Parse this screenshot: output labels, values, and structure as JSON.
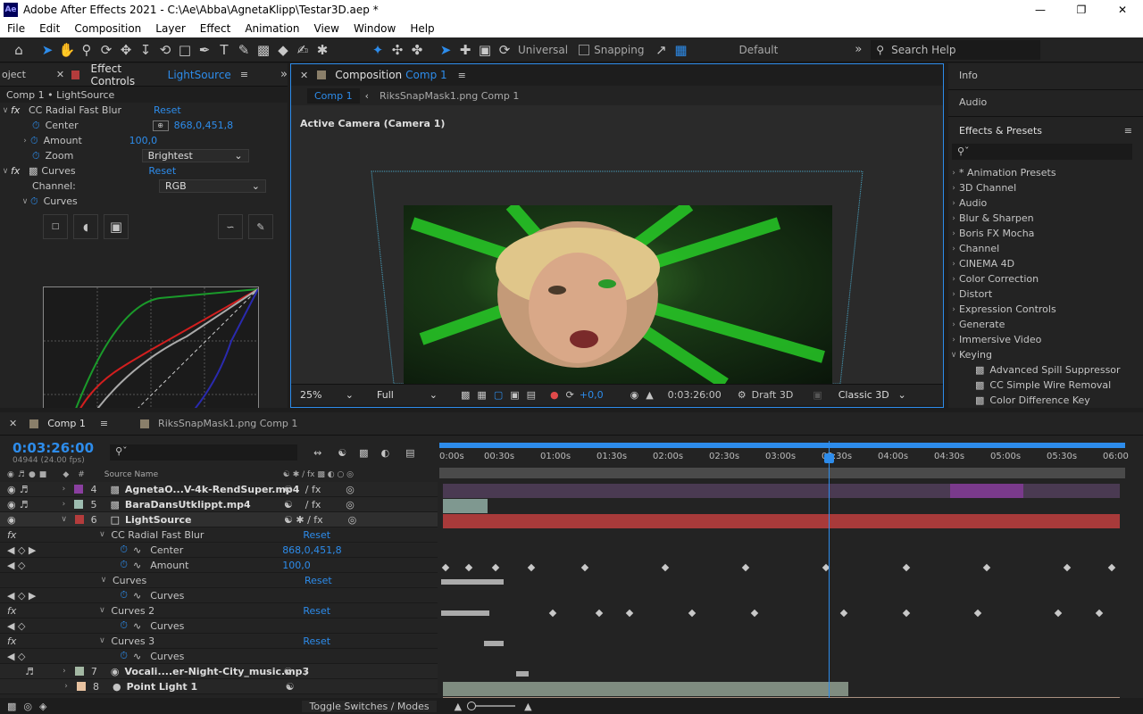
{
  "window": {
    "title": "Adobe After Effects 2021 - C:\\Ae\\Abba\\AgnetaKlipp\\Testar3D.aep *",
    "logo": "Ae"
  },
  "menu": [
    "File",
    "Edit",
    "Composition",
    "Layer",
    "Effect",
    "Animation",
    "View",
    "Window",
    "Help"
  ],
  "toolbar": {
    "axis_mode": "Universal",
    "snapping": "Snapping",
    "workspace": "Default",
    "search_placeholder": "Search Help"
  },
  "left": {
    "tab_project": "oject",
    "tab_effect_controls": "Effect Controls",
    "tab_layer": "LightSource",
    "breadcrumb": "Comp 1 • LightSource",
    "effects": [
      {
        "name": "CC Radial Fast Blur",
        "reset": "Reset"
      },
      {
        "name": "Curves",
        "reset": "Reset"
      }
    ],
    "center_label": "Center",
    "center_value": "868,0,451,8",
    "amount_label": "Amount",
    "amount_value": "100,0",
    "zoom_label": "Zoom",
    "zoom_value": "Brightest",
    "channel_label": "Channel:",
    "channel_value": "RGB",
    "curves_label": "Curves"
  },
  "comp": {
    "tab_label": "Composition",
    "tab_comp": "Comp 1",
    "crumb1": "Comp 1",
    "crumb2": "RiksSnapMask1.png Comp 1",
    "camera": "Active Camera (Camera 1)",
    "zoom": "25%",
    "resolution": "Full",
    "exposure": "+0,0",
    "timecode": "0:03:26:00",
    "renderer": "Draft 3D",
    "mode": "Classic 3D"
  },
  "right": {
    "info": "Info",
    "audio": "Audio",
    "effects_presets": "Effects & Presets",
    "categories": [
      "* Animation Presets",
      "3D Channel",
      "Audio",
      "Blur & Sharpen",
      "Boris FX Mocha",
      "Channel",
      "CINEMA 4D",
      "Color Correction",
      "Distort",
      "Expression Controls",
      "Generate",
      "Immersive Video",
      "Keying"
    ],
    "keying_items": [
      "Advanced Spill Suppressor",
      "CC Simple Wire Removal",
      "Color Difference Key"
    ]
  },
  "timeline": {
    "tab1": "Comp 1",
    "tab2": "RiksSnapMask1.png Comp 1",
    "timecode": "0:03:26:00",
    "frames": "04944 (24.00 fps)",
    "col_source": "Source Name",
    "ruler": [
      "0:00s",
      "00:30s",
      "01:00s",
      "01:30s",
      "02:00s",
      "02:30s",
      "03:00s",
      "03:30s",
      "04:00s",
      "04:30s",
      "05:00s",
      "05:30s",
      "06:00"
    ],
    "layers": [
      {
        "num": "4",
        "name": "AgnetaO...V-4k-RendSuper.mp4",
        "color": "#8a3fa0"
      },
      {
        "num": "5",
        "name": "BaraDansUtklippt.mp4",
        "color": "#9dbcb0"
      },
      {
        "num": "6",
        "name": "LightSource",
        "color": "#b43c3c"
      },
      {
        "num": "7",
        "name": "Vocali....er-Night-City_music.mp3",
        "color": "#a3b8a3"
      },
      {
        "num": "8",
        "name": "Point Light 1",
        "color": "#e8c2a0"
      }
    ],
    "props": {
      "ccrfb": "CC Radial Fast Blur",
      "center": "Center",
      "center_val": "868,0,451,8",
      "amount": "Amount",
      "amount_val": "100,0",
      "curves": "Curves",
      "curves2": "Curves 2",
      "curves3": "Curves 3",
      "reset": "Reset"
    },
    "toggle": "Toggle Switches / Modes"
  }
}
